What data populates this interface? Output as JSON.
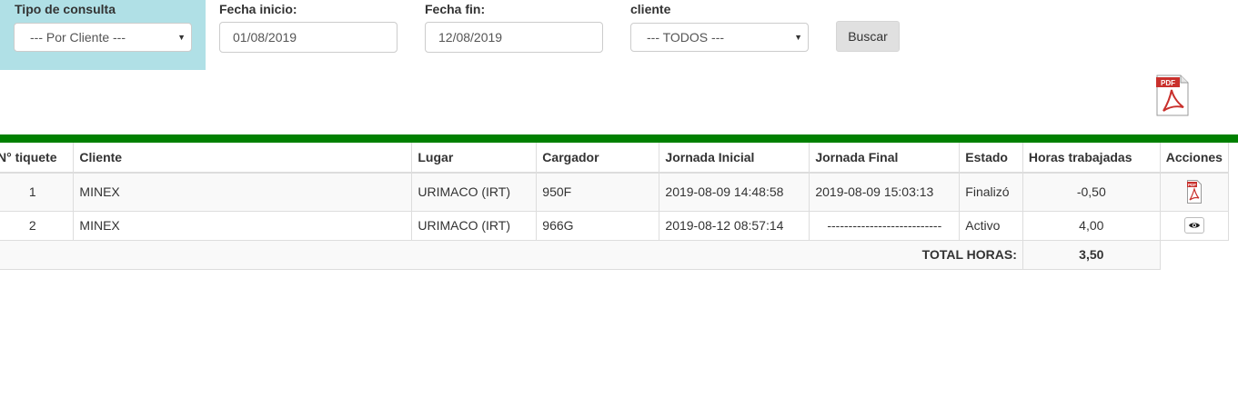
{
  "filters": {
    "tipo_consulta": {
      "label": "Tipo de consulta",
      "value": "--- Por Cliente ---"
    },
    "fecha_inicio": {
      "label": "Fecha inicio:",
      "value": "01/08/2019"
    },
    "fecha_fin": {
      "label": "Fecha fin:",
      "value": "12/08/2019"
    },
    "cliente": {
      "label": "cliente",
      "value": "--- TODOS ---"
    },
    "buscar_label": "Buscar"
  },
  "icons": {
    "pdf_export": "pdf-icon",
    "row_pdf": "pdf-icon",
    "row_view": "eye-icon"
  },
  "colors": {
    "filter_highlight": "#b0e0e6",
    "green_bar": "#008000",
    "pdf_red": "#c9302c"
  },
  "table": {
    "headers": [
      "N° tiquete",
      "Cliente",
      "Lugar",
      "Cargador",
      "Jornada Inicial",
      "Jornada Final",
      "Estado",
      "Horas trabajadas",
      "Acciones"
    ],
    "rows": [
      {
        "tiquete": "1",
        "cliente": "MINEX",
        "lugar": "URIMACO (IRT)",
        "cargador": "950F",
        "jornada_inicial": "2019-08-09 14:48:58",
        "jornada_final": "2019-08-09 15:03:13",
        "estado": "Finalizó",
        "horas": "-0,50",
        "accion": "pdf-icon"
      },
      {
        "tiquete": "2",
        "cliente": "MINEX",
        "lugar": "URIMACO (IRT)",
        "cargador": "966G",
        "jornada_inicial": "2019-08-12 08:57:14",
        "jornada_final": "---------------------------",
        "estado": "Activo",
        "horas": "4,00",
        "accion": "eye-icon"
      }
    ],
    "total_label": "TOTAL HORAS:",
    "total_value": "3,50"
  }
}
